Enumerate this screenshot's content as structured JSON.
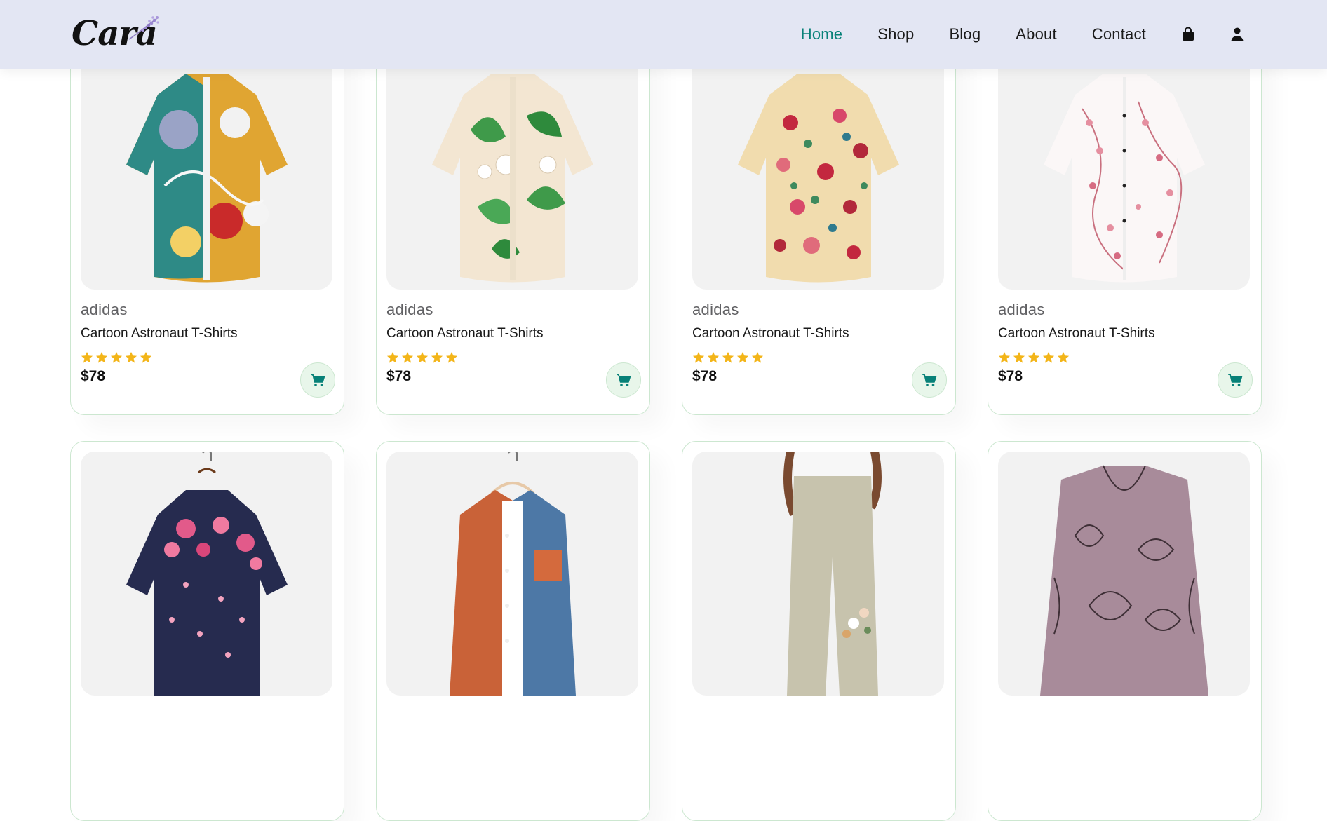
{
  "header": {
    "logo_text": "Cara",
    "nav": {
      "home": "Home",
      "shop": "Shop",
      "blog": "Blog",
      "about": "About",
      "contact": "Contact"
    },
    "icons": [
      "shopping-bag-icon",
      "user-icon"
    ],
    "accent_color": "#088178",
    "background_color": "#e3e6f3"
  },
  "products": [
    {
      "brand": "adidas",
      "title": "Cartoon Astronaut T-Shirts",
      "rating": 5,
      "price": "$78",
      "image": "abstract-print-shirt"
    },
    {
      "brand": "adidas",
      "title": "Cartoon Astronaut T-Shirts",
      "rating": 5,
      "price": "$78",
      "image": "lily-print-shirt"
    },
    {
      "brand": "adidas",
      "title": "Cartoon Astronaut T-Shirts",
      "rating": 5,
      "price": "$78",
      "image": "rose-print-shirt"
    },
    {
      "brand": "adidas",
      "title": "Cartoon Astronaut T-Shirts",
      "rating": 5,
      "price": "$78",
      "image": "blossom-print-shirt"
    },
    {
      "image": "navy-floral-shirt"
    },
    {
      "image": "corduroy-colorblock-jacket"
    },
    {
      "image": "linen-embroidered-pants"
    },
    {
      "image": "cat-print-top"
    }
  ],
  "colors": {
    "star": "#f3b519",
    "cart_bg": "#e8f6ea",
    "card_border": "#cce7d0"
  }
}
